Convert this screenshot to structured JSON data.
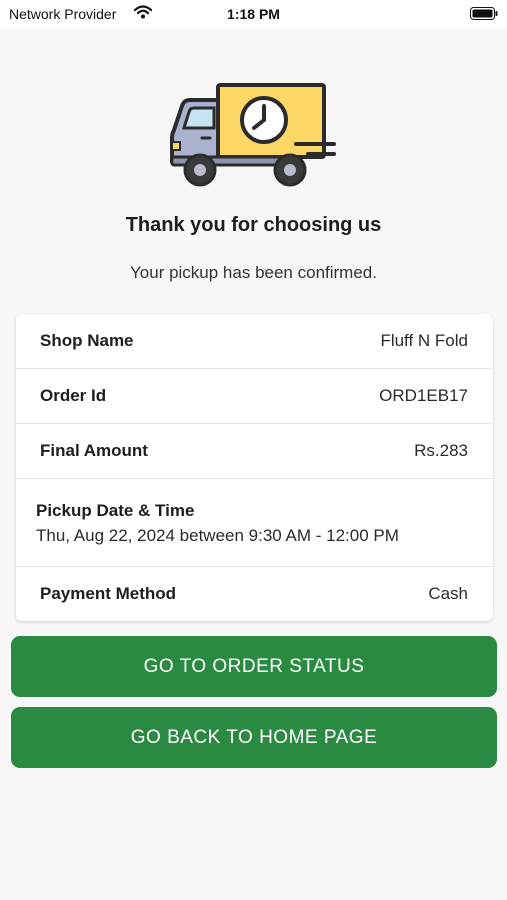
{
  "status_bar": {
    "carrier": "Network Provider",
    "time": "1:18 PM",
    "icons": [
      "wifi-icon",
      "battery-icon"
    ]
  },
  "hero": {
    "icon": "delivery-truck-clock-icon"
  },
  "confirmation": {
    "title": "Thank you for choosing us",
    "subtitle": "Your pickup has been confirmed."
  },
  "order_details": {
    "shop_name_label": "Shop Name",
    "shop_name_value": "Fluff N Fold",
    "order_id_label": "Order Id",
    "order_id_value": "ORD1EB17",
    "final_amount_label": "Final Amount",
    "final_amount_value": "Rs.283",
    "pickup_label": "Pickup Date & Time",
    "pickup_value": "Thu, Aug 22, 2024 between 9:30 AM - 12:00 PM",
    "payment_label": "Payment Method",
    "payment_value": "Cash"
  },
  "actions": {
    "order_status_label": "GO TO ORDER STATUS",
    "home_label": "GO BACK TO HOME PAGE"
  },
  "colors": {
    "button": "#2a8a42",
    "truck_body": "#fdd765",
    "truck_cab": "#aab2cf",
    "outline": "#2b2b2b"
  }
}
